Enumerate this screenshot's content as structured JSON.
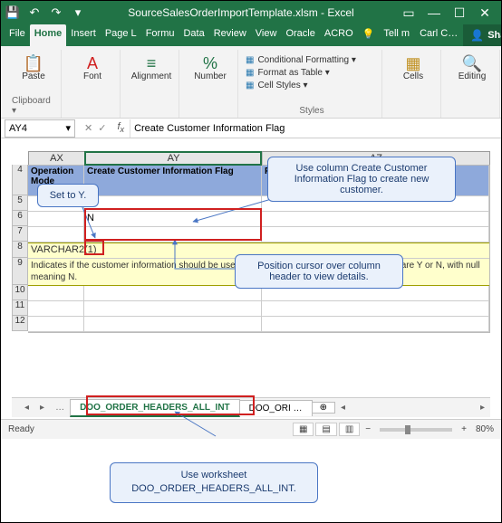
{
  "title": "SourceSalesOrderImportTemplate.xlsm - Excel",
  "tabs": {
    "file": "File",
    "home": "Home",
    "insert": "Insert",
    "page": "Page L",
    "formulas": "Formu",
    "data": "Data",
    "review": "Review",
    "view": "View",
    "oracle": "Oracle",
    "acrobat": "ACRO",
    "tellme": "Tell m",
    "user": "Carl C…",
    "share": "Share"
  },
  "ribbon": {
    "clipboard": {
      "label": "Clipboard",
      "paste": "Paste"
    },
    "font": {
      "label": "Font"
    },
    "alignment": {
      "label": "Alignment"
    },
    "number": {
      "label": "Number"
    },
    "styles": {
      "label": "Styles",
      "cond": "Conditional Formatting",
      "table": "Format as Table",
      "cell": "Cell Styles"
    },
    "cells": {
      "label": "Cells"
    },
    "editing": {
      "label": "Editing"
    }
  },
  "namebox": "AY4",
  "formula": "Create Customer Information Flag",
  "columns": {
    "ax": "AX",
    "ay": "AY",
    "az": "AZ"
  },
  "rows": [
    "4",
    "5",
    "6",
    "7",
    "8",
    "9",
    "10",
    "11",
    "12"
  ],
  "headers": {
    "ax": "Operation Mode",
    "ay": "Create Customer Information Flag",
    "az": "Revision Source Transaction System"
  },
  "cells": {
    "r5_ay": "Y",
    "r6_ay": "N",
    "note_type": "VARCHAR2(1)",
    "note_desc": "Indicates if the customer information should be used to create a new customer entry.  Values are Y or N, with null meaning N."
  },
  "callouts": {
    "setY": "Set to Y.",
    "useCol": "Use column Create Customer Information Flag to create new customer.",
    "position": "Position cursor over column header to view details.",
    "useSheet1": "Use worksheet",
    "useSheet2": "DOO_ORDER_HEADERS_ALL_INT."
  },
  "sheets": {
    "active": "DOO_ORDER_HEADERS_ALL_INT",
    "next": "DOO_ORI …"
  },
  "status": {
    "ready": "Ready",
    "zoom": "80%"
  }
}
